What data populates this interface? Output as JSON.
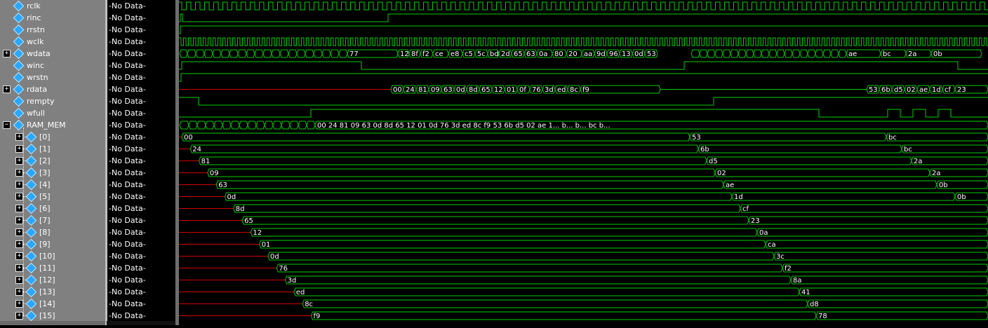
{
  "colors": {
    "wave_green": "#00d000",
    "undef_red": "#d00000",
    "panel_gray": "#808080",
    "icon_blue": "#2aa7ff"
  },
  "no_data_text": "-No Data-",
  "signals": [
    {
      "name": "rclk",
      "expandable": false,
      "level": 0
    },
    {
      "name": "rinc",
      "expandable": false,
      "level": 0
    },
    {
      "name": "rrstn",
      "expandable": false,
      "level": 0
    },
    {
      "name": "wclk",
      "expandable": false,
      "level": 0
    },
    {
      "name": "wdata",
      "expandable": true,
      "expanded": false,
      "level": 0
    },
    {
      "name": "winc",
      "expandable": false,
      "level": 0
    },
    {
      "name": "wrstn",
      "expandable": false,
      "level": 0
    },
    {
      "name": "rdata",
      "expandable": true,
      "expanded": false,
      "level": 0
    },
    {
      "name": "rempty",
      "expandable": false,
      "level": 0
    },
    {
      "name": "wfull",
      "expandable": false,
      "level": 0
    },
    {
      "name": "RAM_MEM",
      "expandable": true,
      "expanded": true,
      "level": 0
    },
    {
      "name": "[0]",
      "expandable": true,
      "expanded": false,
      "level": 1
    },
    {
      "name": "[1]",
      "expandable": true,
      "expanded": false,
      "level": 1
    },
    {
      "name": "[2]",
      "expandable": true,
      "expanded": false,
      "level": 1
    },
    {
      "name": "[3]",
      "expandable": true,
      "expanded": false,
      "level": 1
    },
    {
      "name": "[4]",
      "expandable": true,
      "expanded": false,
      "level": 1
    },
    {
      "name": "[5]",
      "expandable": true,
      "expanded": false,
      "level": 1
    },
    {
      "name": "[6]",
      "expandable": true,
      "expanded": false,
      "level": 1
    },
    {
      "name": "[7]",
      "expandable": true,
      "expanded": false,
      "level": 1
    },
    {
      "name": "[8]",
      "expandable": true,
      "expanded": false,
      "level": 1
    },
    {
      "name": "[9]",
      "expandable": true,
      "expanded": false,
      "level": 1
    },
    {
      "name": "[10]",
      "expandable": true,
      "expanded": false,
      "level": 1
    },
    {
      "name": "[11]",
      "expandable": true,
      "expanded": false,
      "level": 1
    },
    {
      "name": "[12]",
      "expandable": true,
      "expanded": false,
      "level": 1
    },
    {
      "name": "[13]",
      "expandable": true,
      "expanded": false,
      "level": 1
    },
    {
      "name": "[14]",
      "expandable": true,
      "expanded": false,
      "level": 1
    },
    {
      "name": "[15]",
      "expandable": true,
      "expanded": false,
      "level": 1
    }
  ],
  "wave_labels": {
    "wdata": [
      "77",
      "12",
      "8f",
      "f2",
      "ce",
      "e8",
      "c5",
      "5c",
      "bd",
      "2d",
      "65",
      "63",
      "0a",
      "80",
      "20",
      "aa",
      "9d",
      "96",
      "13",
      "0d",
      "53",
      "ae",
      "bc",
      "2a",
      "0b"
    ],
    "rdata": [
      "00",
      "24",
      "81",
      "09",
      "63",
      "0d",
      "8d",
      "65",
      "12",
      "01",
      "0f",
      "76",
      "3d",
      "ed",
      "8c",
      "f9",
      "53",
      "6b",
      "d5",
      "02",
      "ae",
      "1d",
      "cf",
      "23"
    ],
    "ram_mem_1": "00 24 81 09 63 0d 8d 65 12 01 0d 76 3d ed 8c f9",
    "ram_mem_2": "53 6b d5 02 ae 1...",
    "ram_mem_3": "b...",
    "ram_mem_4": "b...",
    "ram_mem_5": "bc b...",
    "mem_first": [
      "00",
      "24",
      "81",
      "09",
      "63",
      "0d",
      "8d",
      "65",
      "12",
      "01",
      "0d",
      "76",
      "3d",
      "ed",
      "8c",
      "f9"
    ],
    "mem_second": [
      "53",
      "6b",
      "d5",
      "02",
      "ae",
      "1d",
      "cf",
      "23",
      "0a",
      "ca",
      "3c",
      "f2",
      "8a",
      "41",
      "d8",
      "78"
    ],
    "mem_third": [
      "bc",
      "bc",
      "2a",
      "2a",
      "0b",
      "0b"
    ]
  }
}
